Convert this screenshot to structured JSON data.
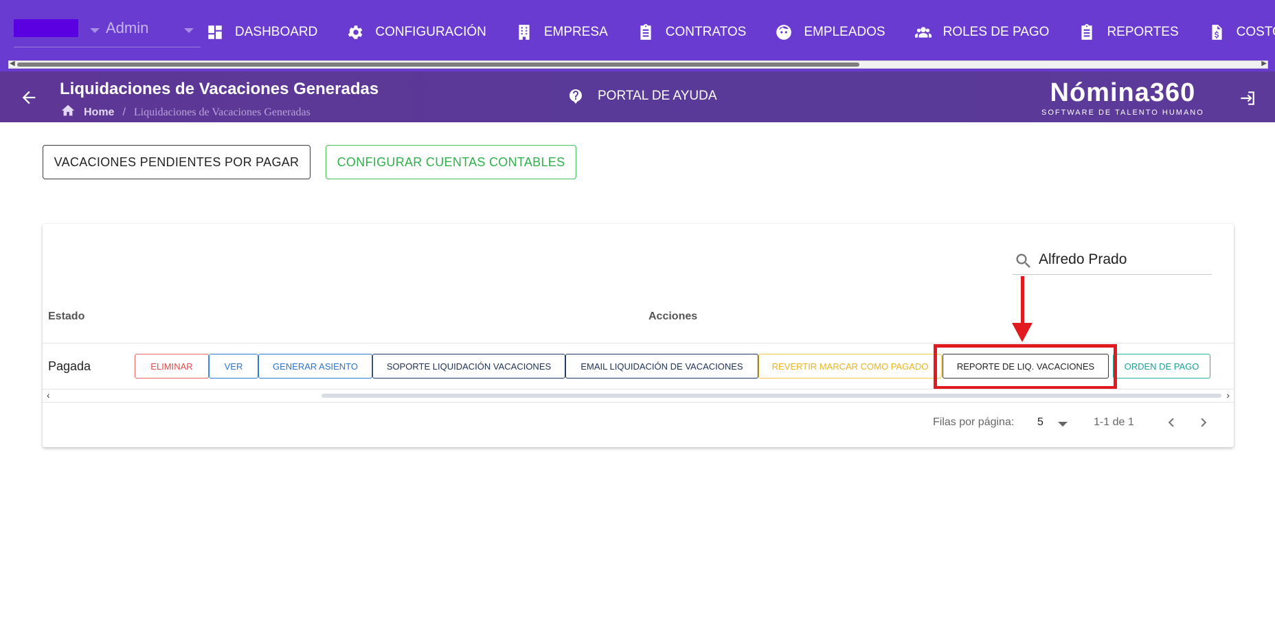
{
  "topnav": {
    "user_label": "Admin",
    "items": [
      {
        "label": "DASHBOARD",
        "icon": "dashboard-icon"
      },
      {
        "label": "CONFIGURACIÓN",
        "icon": "gear-icon"
      },
      {
        "label": "EMPRESA",
        "icon": "building-icon"
      },
      {
        "label": "CONTRATOS",
        "icon": "clipboard-icon"
      },
      {
        "label": "EMPLEADOS",
        "icon": "face-icon"
      },
      {
        "label": "ROLES DE PAGO",
        "icon": "group-icon"
      },
      {
        "label": "REPORTES",
        "icon": "clipboard-icon"
      },
      {
        "label": "COSTOS",
        "icon": "invoice-dollar-icon"
      }
    ]
  },
  "header": {
    "title": "Liquidaciones de Vacaciones Generadas",
    "breadcrumb_home": "Home",
    "breadcrumb_sep": "/",
    "breadcrumb_current": "Liquidaciones de Vacaciones Generadas",
    "help_label": "PORTAL DE AYUDA",
    "brand_name": "Nómina360",
    "brand_tagline": "SOFTWARE DE TALENTO HUMANO"
  },
  "actions_top": {
    "pending_label": "VACACIONES PENDIENTES POR PAGAR",
    "accounts_label": "CONFIGURAR CUENTAS CONTABLES"
  },
  "table": {
    "search_value": "Alfredo Prado",
    "headers": {
      "estado": "Estado",
      "acciones": "Acciones"
    },
    "rows": [
      {
        "estado": "Pagada",
        "actions": {
          "eliminar": "ELIMINAR",
          "ver": "VER",
          "generar_asiento": "GENERAR ASIENTO",
          "soporte": "SOPORTE LIQUIDACIÓN VACACIONES",
          "email": "EMAIL LIQUIDACIÓN DE VACACIONES",
          "revertir": "REVERTIR MARCAR COMO PAGADO",
          "reporte": "REPORTE DE LIQ. VACACIONES",
          "orden_pago": "ORDEN DE PAGO"
        }
      }
    ],
    "footer": {
      "rows_per_page_label": "Filas por página:",
      "rows_per_page_value": "5",
      "range": "1-1 de 1"
    }
  },
  "colors": {
    "nav_bg": "#6a3bd0",
    "header_bg": "#5b3a99",
    "highlight": "#e01a1f",
    "accounts_green": "#2fb14a"
  }
}
